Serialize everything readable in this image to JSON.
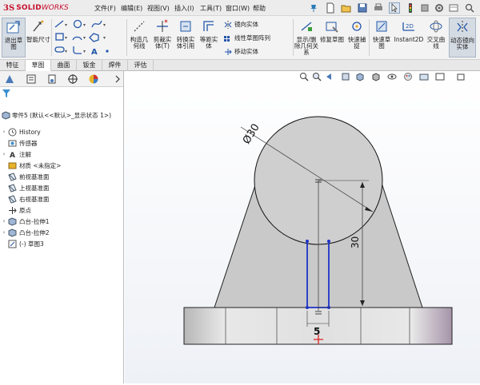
{
  "app": {
    "logo_ds": "3S",
    "logo_solid": "SOLID",
    "logo_works": "WORKS"
  },
  "menu": [
    {
      "label": "文件(F)"
    },
    {
      "label": "编辑(E)"
    },
    {
      "label": "视图(V)"
    },
    {
      "label": "插入(I)"
    },
    {
      "label": "工具(T)"
    },
    {
      "label": "窗口(W)"
    },
    {
      "label": "帮助"
    }
  ],
  "ribbon": {
    "exit_sketch": "退出草图",
    "smart_dim": "智能尺寸",
    "construct_geom": "构造几何线",
    "trim": "剪裁实体(T)",
    "convert": "转换实体引用",
    "offset": "等距实体",
    "mirror": "镜向实体",
    "linear_pattern": "线性草图阵列",
    "move": "移动实体",
    "display_relations": "显示/删除几何关系",
    "repair": "修复草图",
    "quick_snap": "快速捕捉",
    "rapid_sketch": "快速草图",
    "instant2d": "Instant2D",
    "intersection": "交叉曲线",
    "dynamic_mirror": "动态镜向实体"
  },
  "tabs": [
    {
      "label": "特征"
    },
    {
      "label": "草图"
    },
    {
      "label": "曲面"
    },
    {
      "label": "钣金"
    },
    {
      "label": "焊件"
    },
    {
      "label": "评估"
    }
  ],
  "active_tab": "草图",
  "feature_tree": {
    "header": "零件5 (默认<<默认>_显示状态 1>)",
    "items": [
      {
        "label": "History",
        "icon": "history-icon",
        "expandable": true
      },
      {
        "label": "传感器",
        "icon": "sensor-icon",
        "expandable": false
      },
      {
        "label": "注解",
        "icon": "annotation-icon",
        "expandable": true
      },
      {
        "label": "材质 <未指定>",
        "icon": "material-icon",
        "expandable": false
      },
      {
        "label": "前视基准面",
        "icon": "plane-icon",
        "expandable": false
      },
      {
        "label": "上视基准面",
        "icon": "plane-icon",
        "expandable": false
      },
      {
        "label": "右视基准面",
        "icon": "plane-icon",
        "expandable": false
      },
      {
        "label": "原点",
        "icon": "origin-icon",
        "expandable": false
      },
      {
        "label": "凸台-拉伸1",
        "icon": "extrude-icon",
        "expandable": true
      },
      {
        "label": "凸台-拉伸2",
        "icon": "extrude-icon",
        "expandable": true
      },
      {
        "label": "(-) 草图3",
        "icon": "sketch-icon",
        "expandable": false
      }
    ]
  },
  "drawing": {
    "diameter_label": "Ø30",
    "height_label": "30",
    "slot_label": "5"
  },
  "colors": {
    "brand": "#c8102e",
    "sketch_blue": "#1e33c8",
    "part_gray": "#c9c9c9"
  }
}
